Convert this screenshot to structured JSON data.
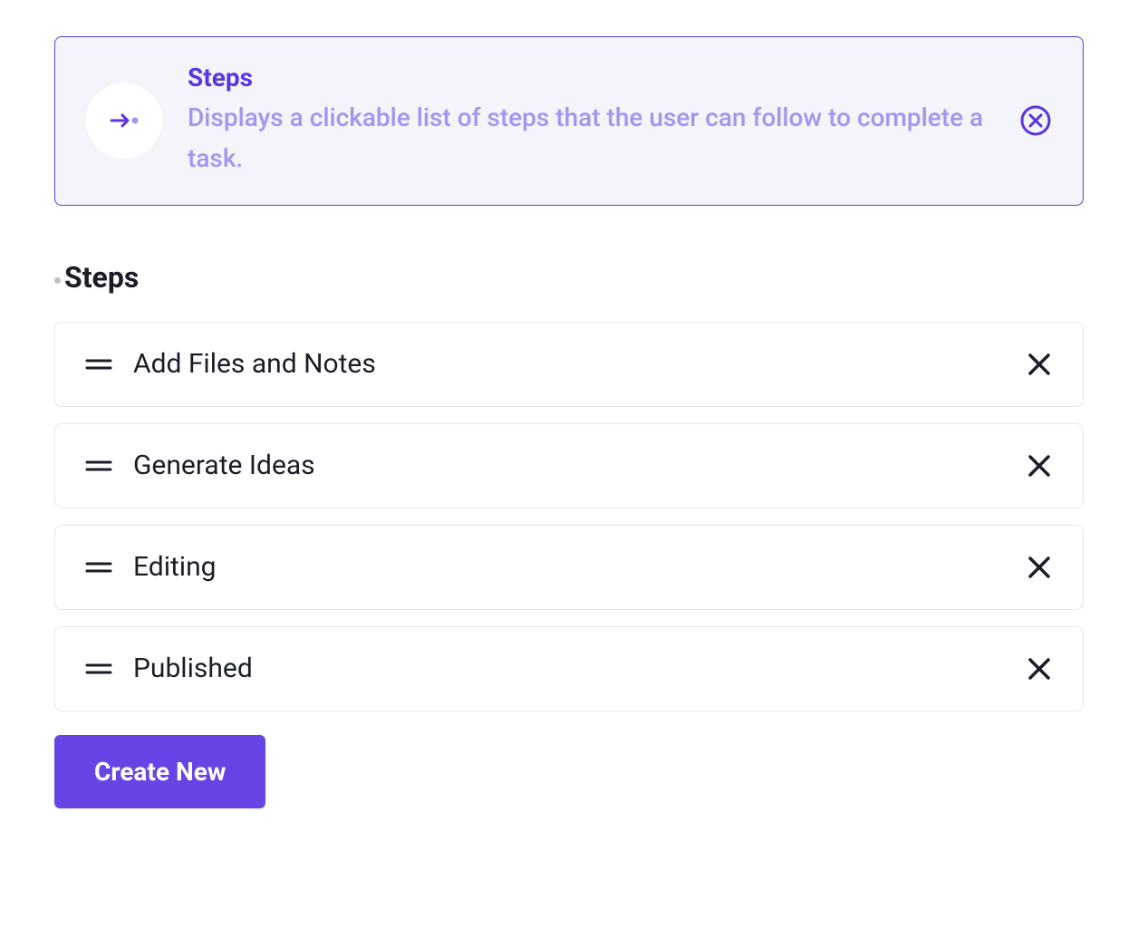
{
  "banner": {
    "title": "Steps",
    "description": "Displays a clickable list of steps that the user can follow to complete a task."
  },
  "section": {
    "title": "Steps"
  },
  "steps": {
    "items": [
      {
        "value": "Add Files and Notes"
      },
      {
        "value": "Generate Ideas"
      },
      {
        "value": "Editing"
      },
      {
        "value": "Published"
      }
    ]
  },
  "actions": {
    "create_new": "Create New"
  }
}
